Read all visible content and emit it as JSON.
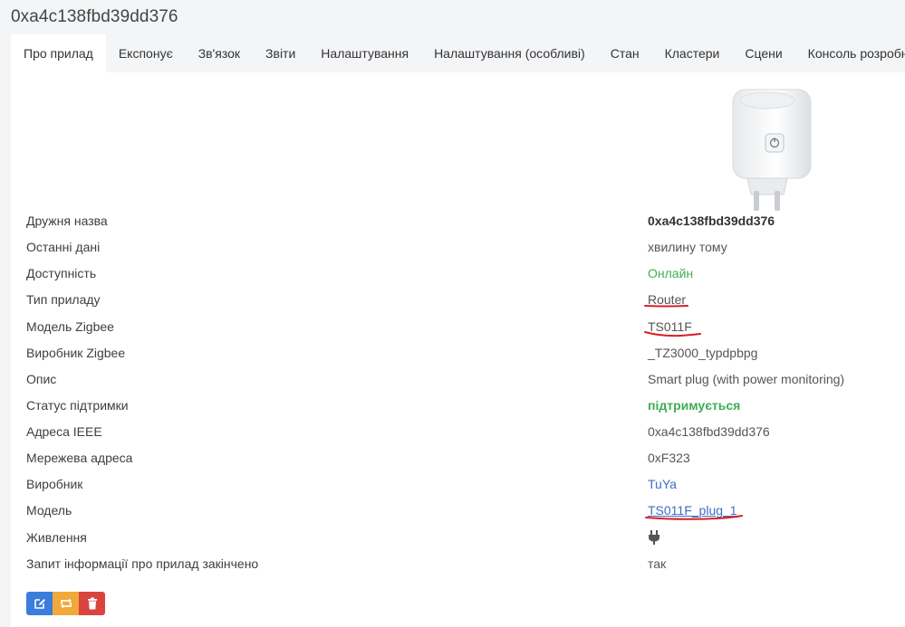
{
  "header": {
    "title": "0xa4c138fbd39dd376"
  },
  "tabs": [
    {
      "label": "Про прилад"
    },
    {
      "label": "Експонує"
    },
    {
      "label": "Зв'язок"
    },
    {
      "label": "Звіти"
    },
    {
      "label": "Налаштування"
    },
    {
      "label": "Налаштування (особливі)"
    },
    {
      "label": "Стан"
    },
    {
      "label": "Кластери"
    },
    {
      "label": "Сцени"
    },
    {
      "label": "Консоль розробника"
    }
  ],
  "info": {
    "friendly_name": {
      "label": "Дружня назва",
      "value": "0xa4c138fbd39dd376"
    },
    "last_seen": {
      "label": "Останні дані",
      "value": "хвилину тому"
    },
    "availability": {
      "label": "Доступність",
      "value": "Онлайн"
    },
    "device_type": {
      "label": "Тип приладу",
      "value": "Router"
    },
    "zigbee_model": {
      "label": "Модель Zigbee",
      "value": "TS011F"
    },
    "zigbee_manufacturer": {
      "label": "Виробник Zigbee",
      "value": "_TZ3000_typdpbpg"
    },
    "description": {
      "label": "Опис",
      "value": "Smart plug (with power monitoring)"
    },
    "support_status": {
      "label": "Статус підтримки",
      "value": "підтримується"
    },
    "ieee_address": {
      "label": "Адреса IEEE",
      "value": "0xa4c138fbd39dd376"
    },
    "network_address": {
      "label": "Мережева адреса",
      "value": "0xF323"
    },
    "manufacturer": {
      "label": "Виробник",
      "value": "TuYa"
    },
    "model": {
      "label": "Модель",
      "value": "TS011F_plug_1"
    },
    "power": {
      "label": "Живлення",
      "icon": "plug-icon"
    },
    "interview_completed": {
      "label": "Запит інформації про прилад закінчено",
      "value": "так"
    }
  },
  "actions": {
    "edit_icon": "edit-icon",
    "reconfigure_icon": "refresh-icon",
    "delete_icon": "trash-icon"
  },
  "colors": {
    "online": "#3fae55",
    "link": "#3a6fc4",
    "annotation": "#d81f26",
    "edit": "#3b7ddd",
    "reconfigure": "#f0a93a",
    "delete": "#d9443f"
  }
}
